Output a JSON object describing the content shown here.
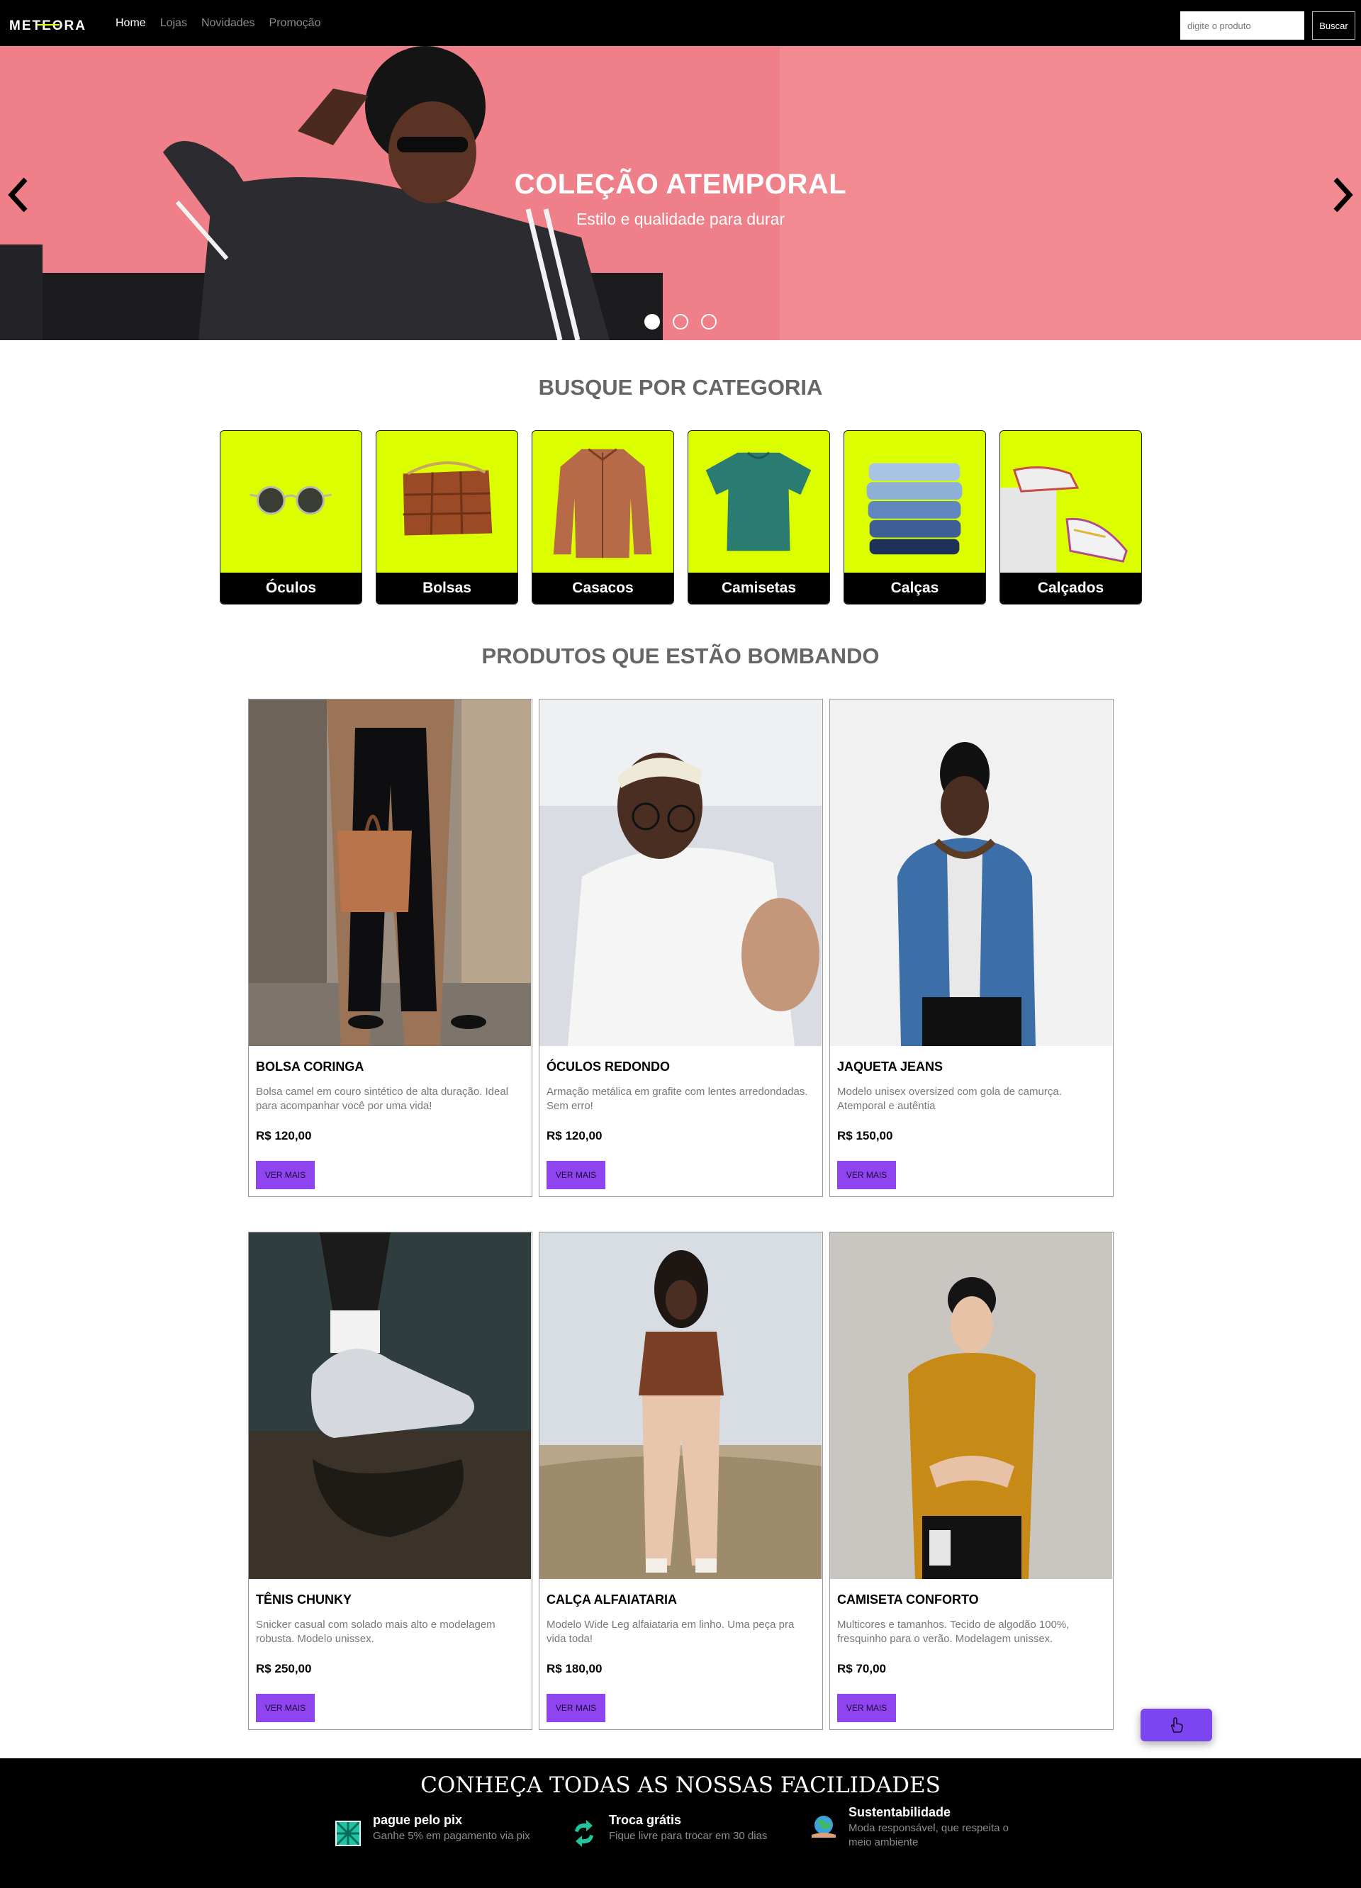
{
  "navbar": {
    "logo": "METEORA",
    "links": [
      {
        "label": "Home",
        "active": true
      },
      {
        "label": "Lojas",
        "active": false
      },
      {
        "label": "Novidades",
        "active": false
      },
      {
        "label": "Promoção",
        "active": false
      }
    ],
    "search_placeholder": "digite o produto",
    "search_button": "Buscar"
  },
  "hero": {
    "title": "COLEÇÃO ATEMPORAL",
    "subtitle": "Estilo e qualidade para durar",
    "slides_count": 3,
    "active_slide": 1,
    "background_color": "#ef7f88"
  },
  "categories": {
    "title": "BUSQUE POR CATEGORIA",
    "items": [
      "Óculos",
      "Bolsas",
      "Casacos",
      "Camisetas",
      "Calças",
      "Calçados"
    ],
    "tile_color": "#dcff00"
  },
  "products": {
    "title": "PRODUTOS QUE ESTÃO BOMBANDO",
    "button_label": "VER MAIS",
    "items": [
      {
        "name": "BOLSA CORINGA",
        "description": "Bolsa camel em couro sintético de alta duração. Ideal para acompanhar você por uma vida!",
        "price": "R$ 120,00"
      },
      {
        "name": "ÓCULOS REDONDO",
        "description": "Armação metálica em grafite com lentes arredondadas. Sem erro!",
        "price": "R$ 120,00"
      },
      {
        "name": "JAQUETA JEANS",
        "description": "Modelo unisex oversized com gola de camurça. Atemporal e autêntia",
        "price": "R$ 150,00"
      },
      {
        "name": "TÊNIS CHUNKY",
        "description": "Snicker casual com solado mais alto e modelagem robusta. Modelo unissex.",
        "price": "R$ 250,00"
      },
      {
        "name": "CALÇA ALFAIATARIA",
        "description": "Modelo Wide Leg alfaiataria em linho. Uma peça pra vida toda!",
        "price": "R$ 180,00"
      },
      {
        "name": "CAMISETA CONFORTO",
        "description": "Multicores e tamanhos. Tecido de algodão 100%, fresquinho para o verão. Modelagem unissex.",
        "price": "R$ 70,00"
      }
    ],
    "button_color": "#8e45f0"
  },
  "footer": {
    "title": "CONHEÇA TODAS AS NOSSAS FACILIDADES",
    "features": [
      {
        "title": "pague pelo pix",
        "text": "Ganhe 5% em pagamento via pix",
        "icon": "pix-icon"
      },
      {
        "title": "Troca grátis",
        "text": "Fique livre para trocar em 30 dias",
        "icon": "exchange-icon"
      },
      {
        "title": "Sustentabilidade",
        "text": "Moda responsável, que respeita o meio ambiente",
        "icon": "sustainability-icon"
      }
    ]
  }
}
